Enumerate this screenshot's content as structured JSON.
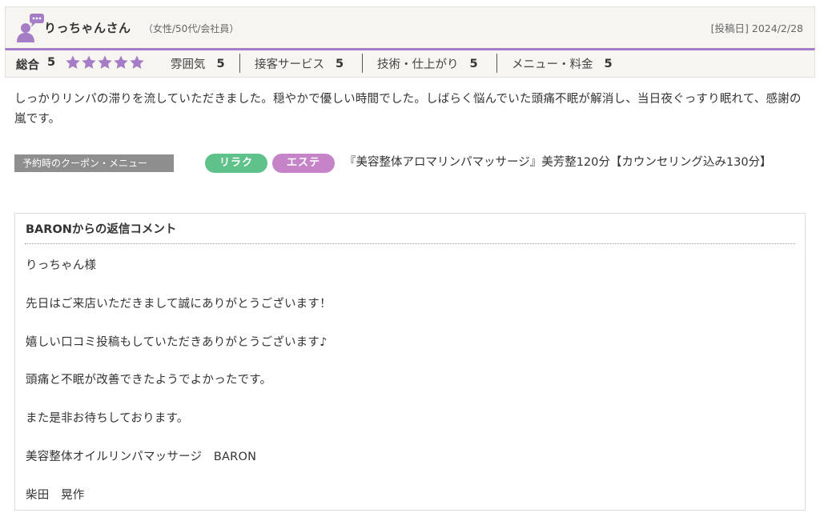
{
  "reviewer": {
    "name": "りっちゃんさん",
    "meta": "（女性/50代/会社員）",
    "post_date": "[投稿日] 2024/2/28"
  },
  "ratings": {
    "overall_label": "総合",
    "overall_score": "5",
    "stars": 5,
    "star_color": "#a57dc7",
    "items": [
      {
        "label": "雰囲気",
        "score": "5"
      },
      {
        "label": "接客サービス",
        "score": "5"
      },
      {
        "label": "技術・仕上がり",
        "score": "5"
      },
      {
        "label": "メニュー・料金",
        "score": "5"
      }
    ]
  },
  "review": {
    "body": "しっかりリンパの滞りを流していただきました。穏やかで優しい時間でした。しばらく悩んでいた頭痛不眠が解消し、当日夜ぐっすり眠れて、感謝の嵐です。"
  },
  "coupon": {
    "label": "予約時のクーポン・メニュー",
    "tags": [
      {
        "text": "リラク",
        "color": "#5fc28a"
      },
      {
        "text": "エステ",
        "color": "#c584c8"
      }
    ],
    "name": "『美容整体アロマリンパマッサージ』美芳整120分【カウンセリング込み130分】"
  },
  "reply": {
    "title": "BARONからの返信コメント",
    "lines": [
      "りっちゃん様",
      "先日はご来店いただきまして誠にありがとうございます！",
      "嬉しい口コミ投稿もしていただきありがとうございます♪",
      "頭痛と不眠が改善できたようでよかったです。",
      "また是非お待ちしております。",
      "美容整体オイルリンパマッサージ　BARON",
      "柴田　晃作"
    ]
  },
  "icons": {
    "avatar": "user-speech-icon",
    "star": "star-icon"
  }
}
